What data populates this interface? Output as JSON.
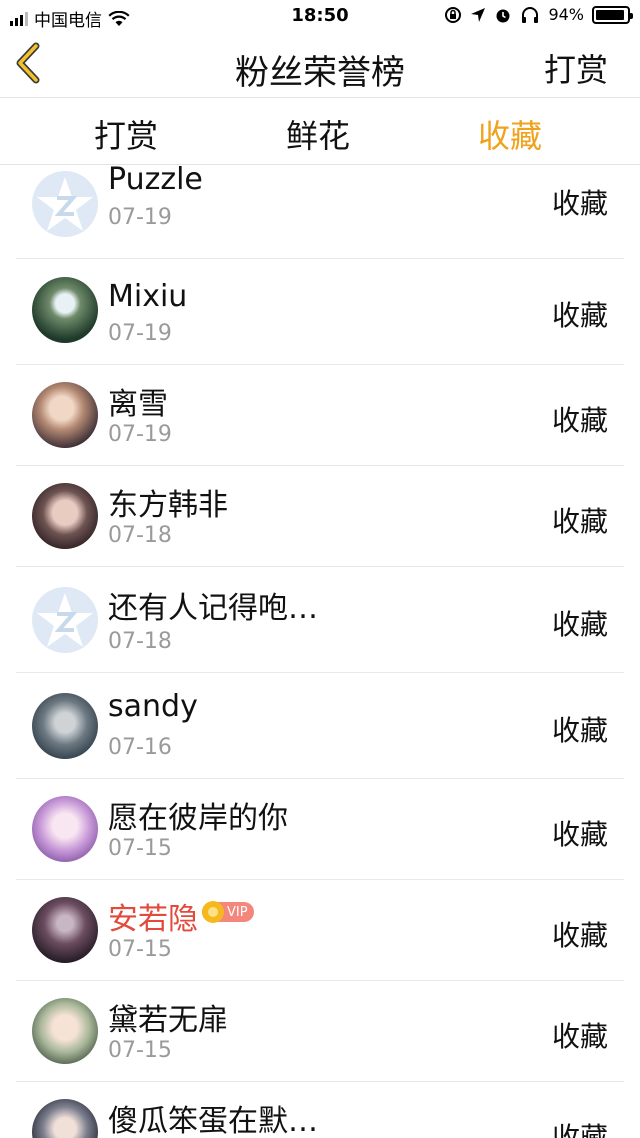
{
  "status_bar": {
    "carrier": "中国电信",
    "time": "18:50",
    "battery": "94%",
    "battery_level": 0.94,
    "icons": [
      "signal-icon",
      "wifi-icon",
      "orientation-lock-icon",
      "location-icon",
      "alarm-icon",
      "headphones-icon",
      "battery-icon"
    ]
  },
  "nav": {
    "title": "粉丝荣誉榜",
    "right_label": "打赏",
    "back_icon": "chevron-left-icon"
  },
  "tabs": [
    {
      "label": "打赏",
      "active": false
    },
    {
      "label": "鲜花",
      "active": false
    },
    {
      "label": "收藏",
      "active": true
    }
  ],
  "colors": {
    "accent": "#f0a21d",
    "vip_name": "#e24a3b",
    "date_gray": "#9a9a9a"
  },
  "rows": [
    {
      "name": "Puzzle",
      "date": "07-19",
      "action": "收藏",
      "avatar": "default-avatar"
    },
    {
      "name": "Mixiu",
      "date": "07-19",
      "action": "收藏",
      "avatar": "waterfall-avatar"
    },
    {
      "name": "离雪",
      "date": "07-19",
      "action": "收藏",
      "avatar": "girl-avatar"
    },
    {
      "name": "东方韩非",
      "date": "07-18",
      "action": "收藏",
      "avatar": "man-avatar"
    },
    {
      "name": "还有人记得咆…",
      "date": "07-18",
      "action": "收藏",
      "avatar": "default-avatar"
    },
    {
      "name": "sandy",
      "date": "07-16",
      "action": "收藏",
      "avatar": "photo-avatar"
    },
    {
      "name": "愿在彼岸的你",
      "date": "07-15",
      "action": "收藏",
      "avatar": "anime-avatar"
    },
    {
      "name": "安若隐",
      "date": "07-15",
      "action": "收藏",
      "avatar": "dark-avatar",
      "vip": true,
      "vip_label": "VIP"
    },
    {
      "name": "黛若无扉",
      "date": "07-15",
      "action": "收藏",
      "avatar": "girl-avatar"
    },
    {
      "name": "傻瓜笨蛋在默…",
      "date": "",
      "action": "收藏",
      "avatar": "boy-avatar"
    }
  ]
}
